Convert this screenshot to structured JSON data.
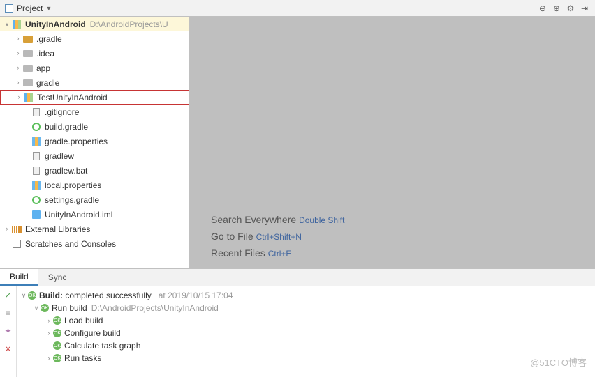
{
  "topbar": {
    "project_label": "Project",
    "icons": {
      "collapse": "⊖",
      "target": "⊕",
      "gear": "⚙",
      "hide": "⇥"
    }
  },
  "tree": {
    "root": {
      "name": "UnityInAndroid",
      "path": "D:\\AndroidProjects\\U"
    },
    "items": [
      {
        "name": ".gradle",
        "icon": "folder-open",
        "expandable": true,
        "indent": 20
      },
      {
        "name": ".idea",
        "icon": "folder-closed",
        "expandable": true,
        "indent": 20
      },
      {
        "name": "app",
        "icon": "folder-closed",
        "expandable": true,
        "indent": 20
      },
      {
        "name": "gradle",
        "icon": "folder-closed",
        "expandable": true,
        "indent": 20
      },
      {
        "name": "TestUnityInAndroid",
        "icon": "module-icon",
        "expandable": true,
        "indent": 20,
        "highlighted": true
      },
      {
        "name": ".gitignore",
        "icon": "file-icon",
        "expandable": false,
        "indent": 32
      },
      {
        "name": "build.gradle",
        "icon": "gradle-icon",
        "expandable": false,
        "indent": 32
      },
      {
        "name": "gradle.properties",
        "icon": "prop-icon",
        "expandable": false,
        "indent": 32
      },
      {
        "name": "gradlew",
        "icon": "file-icon",
        "expandable": false,
        "indent": 32
      },
      {
        "name": "gradlew.bat",
        "icon": "file-icon",
        "expandable": false,
        "indent": 32
      },
      {
        "name": "local.properties",
        "icon": "prop-icon",
        "expandable": false,
        "indent": 32
      },
      {
        "name": "settings.gradle",
        "icon": "gradle-icon",
        "expandable": false,
        "indent": 32
      },
      {
        "name": "UnityInAndroid.iml",
        "icon": "iml-icon",
        "expandable": false,
        "indent": 32
      }
    ],
    "ext_lib": "External Libraries",
    "scratches": "Scratches and Consoles"
  },
  "hints": [
    {
      "text": "Search Everywhere ",
      "key": "Double Shift"
    },
    {
      "text": "Go to File ",
      "key": "Ctrl+Shift+N"
    },
    {
      "text": "Recent Files ",
      "key": "Ctrl+E"
    }
  ],
  "build_tabs": {
    "build": "Build",
    "sync": "Sync"
  },
  "build": {
    "title": "Build:",
    "status": "completed successfully",
    "time": "at 2019/10/15 17:04",
    "run": {
      "label": "Run build",
      "path": "D:\\AndroidProjects\\UnityInAndroid"
    },
    "tasks": [
      "Load build",
      "Configure build",
      "Calculate task graph",
      "Run tasks"
    ]
  },
  "watermark": "@51CTO博客",
  "side_icons": {
    "hammer": "↗",
    "filter": "≡",
    "pin": "✦",
    "close": "✕"
  }
}
